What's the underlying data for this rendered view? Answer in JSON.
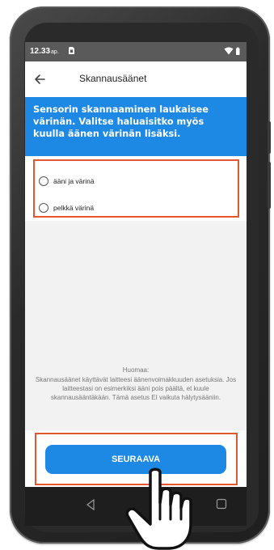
{
  "statusbar": {
    "time": "12.33",
    "ampm": "ap.",
    "icons": [
      "sim-card-icon",
      "wifi-icon",
      "battery-icon"
    ]
  },
  "appbar": {
    "back_icon": "arrow-left-icon",
    "title": "Skannausäänet"
  },
  "banner": {
    "text": "Sensorin skannaaminen laukaisee värinän. Valitse haluaisitko myös kuulla äänen värinän lisäksi."
  },
  "options": [
    {
      "label": "ääni ja värinä",
      "selected": false
    },
    {
      "label": "pelkkä värinä",
      "selected": false
    }
  ],
  "note": {
    "title": "Huomaa:",
    "body": "Skannausäänet käyttävät laitteesi äänenvoimakkuuden asetuksia. Jos laitteestasi on esimerkiksi ääni pois päältä, et kuule skannausääntäkään. Tämä asetus EI vaikuta hälytysääniin."
  },
  "primary_button": {
    "label": "SEURAAVA"
  },
  "navbar": {
    "icons": [
      "nav-back-icon",
      "nav-home-icon",
      "nav-recent-icon"
    ]
  },
  "colors": {
    "accent": "#1e88e5",
    "highlight": "#e4572e",
    "background": "#f2f2f2"
  }
}
